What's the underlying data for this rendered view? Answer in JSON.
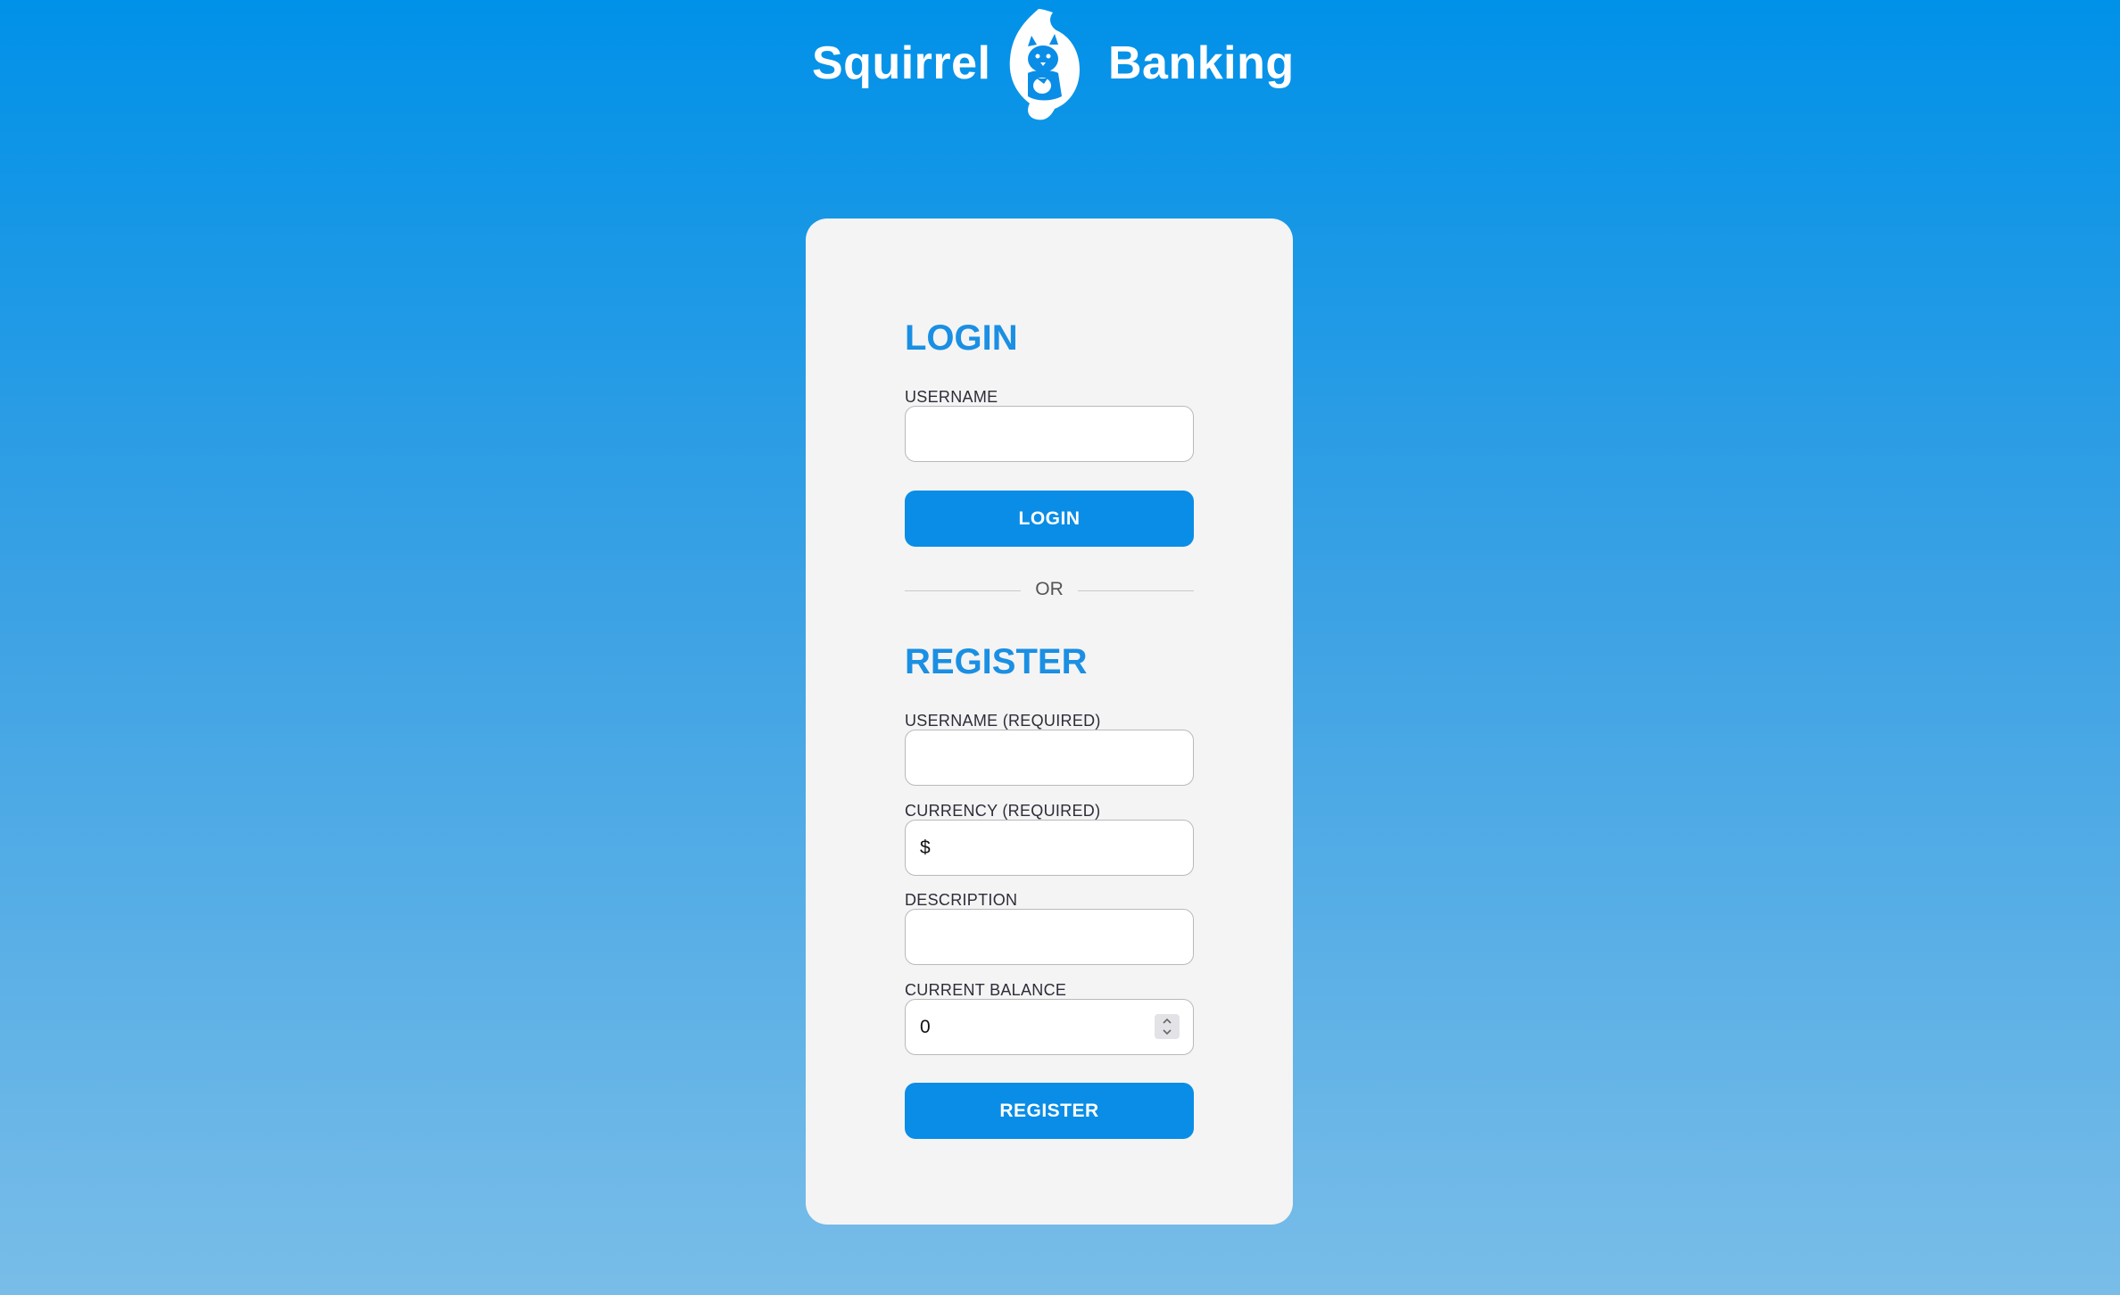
{
  "header": {
    "brand_left": "Squirrel",
    "brand_right": "Banking",
    "logo_icon": "squirrel-logo-icon"
  },
  "colors": {
    "accent": "#0a8de6",
    "title": "#1a8fe3",
    "card_bg": "#f4f4f4"
  },
  "login": {
    "title": "LOGIN",
    "username_label": "USERNAME",
    "username_value": "",
    "button_label": "LOGIN"
  },
  "divider": {
    "text": "OR"
  },
  "register": {
    "title": "REGISTER",
    "username_label": "USERNAME (REQUIRED)",
    "username_value": "",
    "currency_label": "CURRENCY (REQUIRED)",
    "currency_value": "$",
    "description_label": "DESCRIPTION",
    "description_value": "",
    "balance_label": "CURRENT BALANCE",
    "balance_value": "0",
    "button_label": "REGISTER"
  }
}
